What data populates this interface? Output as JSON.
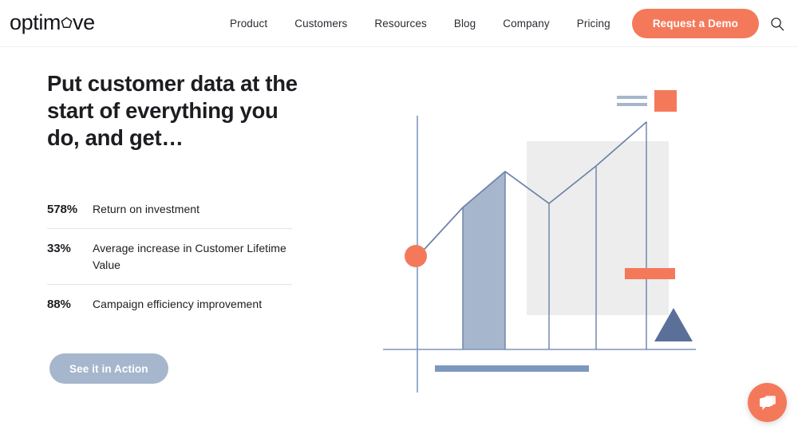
{
  "brand": {
    "logo_pre": "optim",
    "logo_mark": "pentagon-o-icon",
    "logo_post": "ve",
    "accent_color": "#F4795B",
    "muted_blue": "#A5B6CD",
    "slate_blue": "#5A7099",
    "panel_gray": "#EDEDED"
  },
  "header": {
    "nav": [
      {
        "label": "Product"
      },
      {
        "label": "Customers"
      },
      {
        "label": "Resources"
      },
      {
        "label": "Blog"
      },
      {
        "label": "Company"
      },
      {
        "label": "Pricing"
      }
    ],
    "cta_label": "Request a Demo",
    "search_icon": "search-icon"
  },
  "hero": {
    "headline": "Put customer data at the start of everything you do, and get…",
    "stats": [
      {
        "value": "578%",
        "label": "Return on investment"
      },
      {
        "value": "33%",
        "label": "Average increase in Customer Lifetime Value"
      },
      {
        "value": "88%",
        "label": "Campaign efficiency improvement"
      }
    ],
    "action_label": "See it in Action"
  },
  "chat": {
    "icon": "chat-bubbles-icon"
  },
  "chart_data": {
    "type": "area",
    "title": "",
    "xlabel": "",
    "ylabel": "",
    "grid": false,
    "legend_position": "top-right",
    "legend": [
      {
        "name": "series-lines",
        "marker": "two-blue-bars",
        "color": "#A5B6CD"
      },
      {
        "name": "series-square",
        "marker": "orange-square",
        "color": "#F4795B"
      }
    ],
    "x": [
      0,
      1,
      2,
      3,
      4
    ],
    "series": [
      {
        "name": "trend",
        "color": "#6B82A8",
        "values": [
          0.0,
          0.72,
          0.56,
          0.9,
          0.93
        ]
      }
    ],
    "markers": [
      {
        "name": "origin-dot",
        "shape": "circle",
        "color": "#F4795B",
        "x": 0,
        "y": 0.0
      },
      {
        "name": "accent-triangle",
        "shape": "triangle",
        "color": "#5A7099"
      },
      {
        "name": "accent-bar",
        "shape": "rect",
        "color": "#F4795B"
      },
      {
        "name": "baseline-bar",
        "shape": "rect",
        "color": "#7D97BF"
      }
    ],
    "filled_region": {
      "from": 1,
      "to": 2,
      "color": "#A5B6CD"
    },
    "highlight_panel": {
      "color": "#EDEDED"
    }
  }
}
